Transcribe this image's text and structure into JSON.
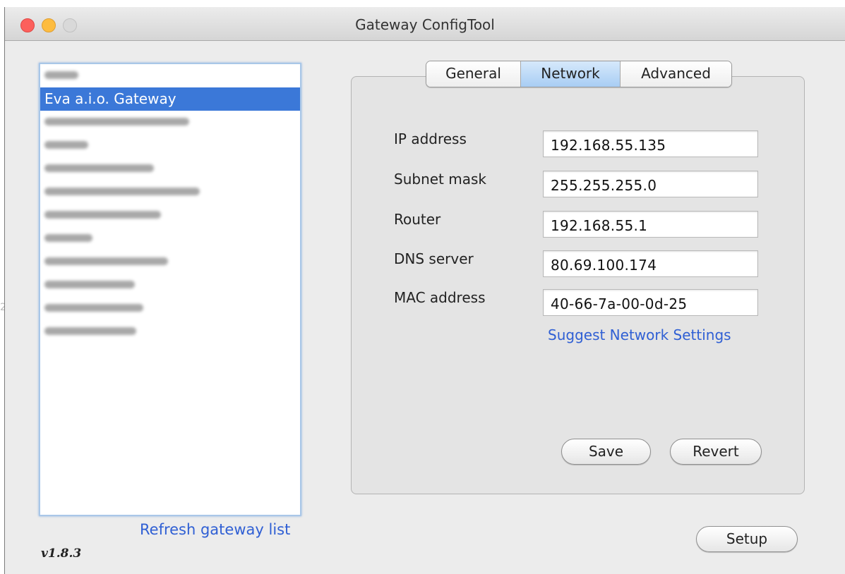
{
  "window": {
    "title": "Gateway ConfigTool"
  },
  "gateway_list": {
    "selected_label": "Eva a.i.o. Gateway",
    "items": [
      {
        "label": "",
        "obscured": true
      },
      {
        "label": "Eva a.i.o. Gateway",
        "obscured": false,
        "selected": true
      },
      {
        "label": "",
        "obscured": true
      },
      {
        "label": "",
        "obscured": true
      },
      {
        "label": "",
        "obscured": true
      },
      {
        "label": "",
        "obscured": true
      },
      {
        "label": "",
        "obscured": true
      },
      {
        "label": "",
        "obscured": true
      },
      {
        "label": "",
        "obscured": true
      },
      {
        "label": "",
        "obscured": true
      },
      {
        "label": "",
        "obscured": true
      },
      {
        "label": "",
        "obscured": true
      }
    ],
    "refresh_label": "Refresh gateway list"
  },
  "version": "v1.8.3",
  "tabs": [
    {
      "label": "General",
      "active": false
    },
    {
      "label": "Network",
      "active": true
    },
    {
      "label": "Advanced",
      "active": false
    }
  ],
  "network": {
    "ip_label": "IP address",
    "ip_value": "192.168.55.135",
    "subnet_label": "Subnet mask",
    "subnet_value": "255.255.255.0",
    "router_label": "Router",
    "router_value": "192.168.55.1",
    "dns_label": "DNS server",
    "dns_value": "80.69.100.174",
    "mac_label": "MAC address",
    "mac_value": "40-66-7a-00-0d-25",
    "suggest_label": "Suggest Network Settings"
  },
  "buttons": {
    "save": "Save",
    "revert": "Revert",
    "setup": "Setup"
  },
  "edge_glyph": "2",
  "colors": {
    "selection": "#3b78d8",
    "link": "#2f5fd4",
    "active_tab": "#a8cdf4"
  }
}
